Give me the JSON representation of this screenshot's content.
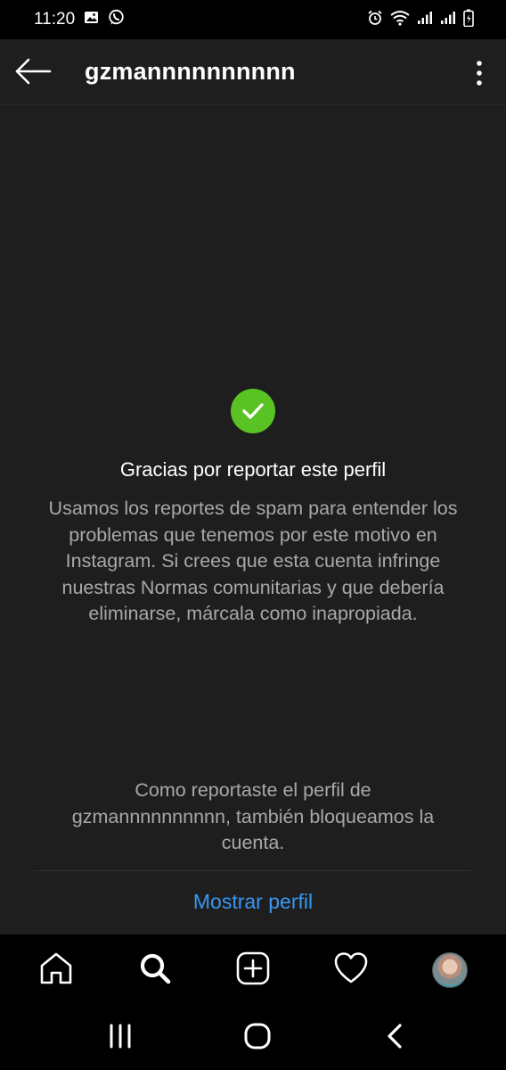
{
  "status_bar": {
    "time": "11:20",
    "left_icons": [
      "image-icon",
      "whatsapp-icon"
    ],
    "right_icons": [
      "alarm-icon",
      "wifi-icon",
      "signal-icon",
      "signal-icon",
      "battery-icon"
    ]
  },
  "header": {
    "username": "gzmannnnnnnnnn",
    "back_icon": "arrow-left-icon",
    "menu_icon": "more-vertical-icon"
  },
  "confirmation": {
    "icon": "check-circle-icon",
    "icon_color": "#58c322",
    "title": "Gracias por reportar este perfil",
    "description": "Usamos los reportes de spam para entender los problemas que tenemos por este motivo en Instagram. Si crees que esta cuenta infringe nuestras Normas comunitarias y que debería eliminarse, márcala como inapropiada."
  },
  "blocked_notice": {
    "text": "Como reportaste el perfil de gzmannnnnnnnnn, también bloqueamos la cuenta."
  },
  "actions": {
    "show_profile": "Mostrar perfil",
    "link_color": "#3897f0"
  },
  "tab_bar": {
    "items": [
      "home-icon",
      "search-icon",
      "add-post-icon",
      "heart-icon",
      "profile-avatar"
    ]
  },
  "system_nav": {
    "items": [
      "recent-apps-icon",
      "home-button-icon",
      "back-icon"
    ]
  }
}
